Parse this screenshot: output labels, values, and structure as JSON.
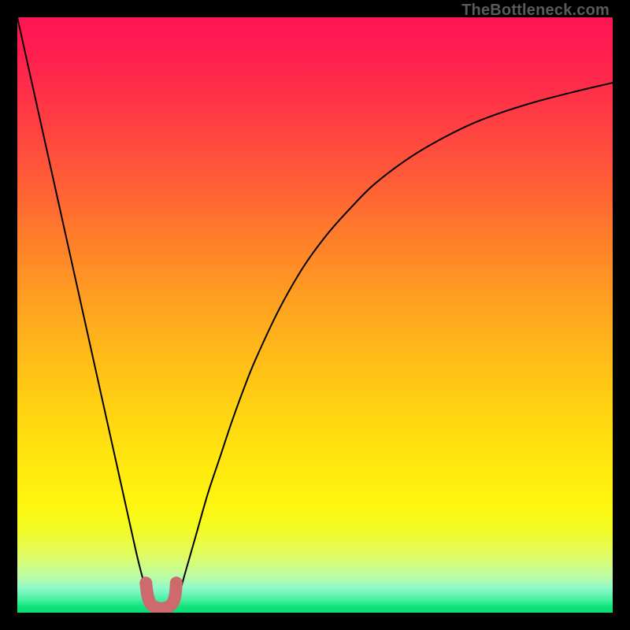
{
  "watermark": "TheBottleneck.com",
  "chart_data": {
    "type": "line",
    "title": "",
    "xlabel": "",
    "ylabel": "",
    "xlim": [
      0,
      100
    ],
    "ylim": [
      0,
      100
    ],
    "grid": false,
    "series": [
      {
        "name": "bottleneck-curve",
        "x": [
          0,
          2,
          4,
          6,
          8,
          10,
          12,
          14,
          16,
          18,
          20,
          21,
          22,
          23,
          24,
          25,
          26,
          27,
          28,
          30,
          32,
          34,
          36,
          38,
          40,
          44,
          48,
          52,
          56,
          60,
          66,
          72,
          78,
          86,
          94,
          100
        ],
        "y": [
          100,
          91,
          82,
          73,
          64,
          55,
          46,
          37,
          28,
          19,
          10,
          6,
          2.5,
          1,
          0.6,
          0.6,
          1,
          2.5,
          6,
          13,
          20,
          26,
          32,
          37.5,
          42.5,
          51,
          58,
          63.5,
          68,
          72,
          76.5,
          80,
          82.8,
          85.5,
          87.6,
          89
        ]
      },
      {
        "name": "optimal-marker",
        "x": [
          21.6,
          21.9,
          22.4,
          23.2,
          24.2,
          25.2,
          26.0,
          26.5,
          26.7
        ],
        "y": [
          5.0,
          2.8,
          1.5,
          0.9,
          0.7,
          0.9,
          1.5,
          2.8,
          5.0
        ]
      }
    ],
    "colors": {
      "curve": "#000000",
      "marker": "#cd6a6e",
      "gradient_top": "#ff1454",
      "gradient_bottom": "#0ddc72"
    }
  }
}
